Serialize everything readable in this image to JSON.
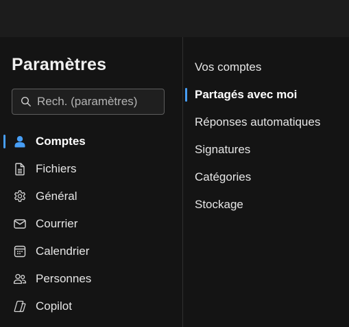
{
  "settings": {
    "title": "Paramètres",
    "search_placeholder": "Rech. (paramètres)"
  },
  "nav": [
    {
      "label": "Comptes",
      "icon": "person-icon",
      "active": true
    },
    {
      "label": "Fichiers",
      "icon": "document-icon",
      "active": false
    },
    {
      "label": "Général",
      "icon": "gear-icon",
      "active": false
    },
    {
      "label": "Courrier",
      "icon": "mail-icon",
      "active": false
    },
    {
      "label": "Calendrier",
      "icon": "calendar-icon",
      "active": false
    },
    {
      "label": "Personnes",
      "icon": "people-icon",
      "active": false
    },
    {
      "label": "Copilot",
      "icon": "copilot-icon",
      "active": false
    }
  ],
  "subnav": [
    {
      "label": "Vos comptes",
      "active": false
    },
    {
      "label": "Partagés avec moi",
      "active": true
    },
    {
      "label": "Réponses automatiques",
      "active": false
    },
    {
      "label": "Signatures",
      "active": false
    },
    {
      "label": "Catégories",
      "active": false
    },
    {
      "label": "Stockage",
      "active": false
    }
  ],
  "colors": {
    "accent": "#479ef5",
    "background": "#141414",
    "topbar": "#1c1c1c"
  }
}
